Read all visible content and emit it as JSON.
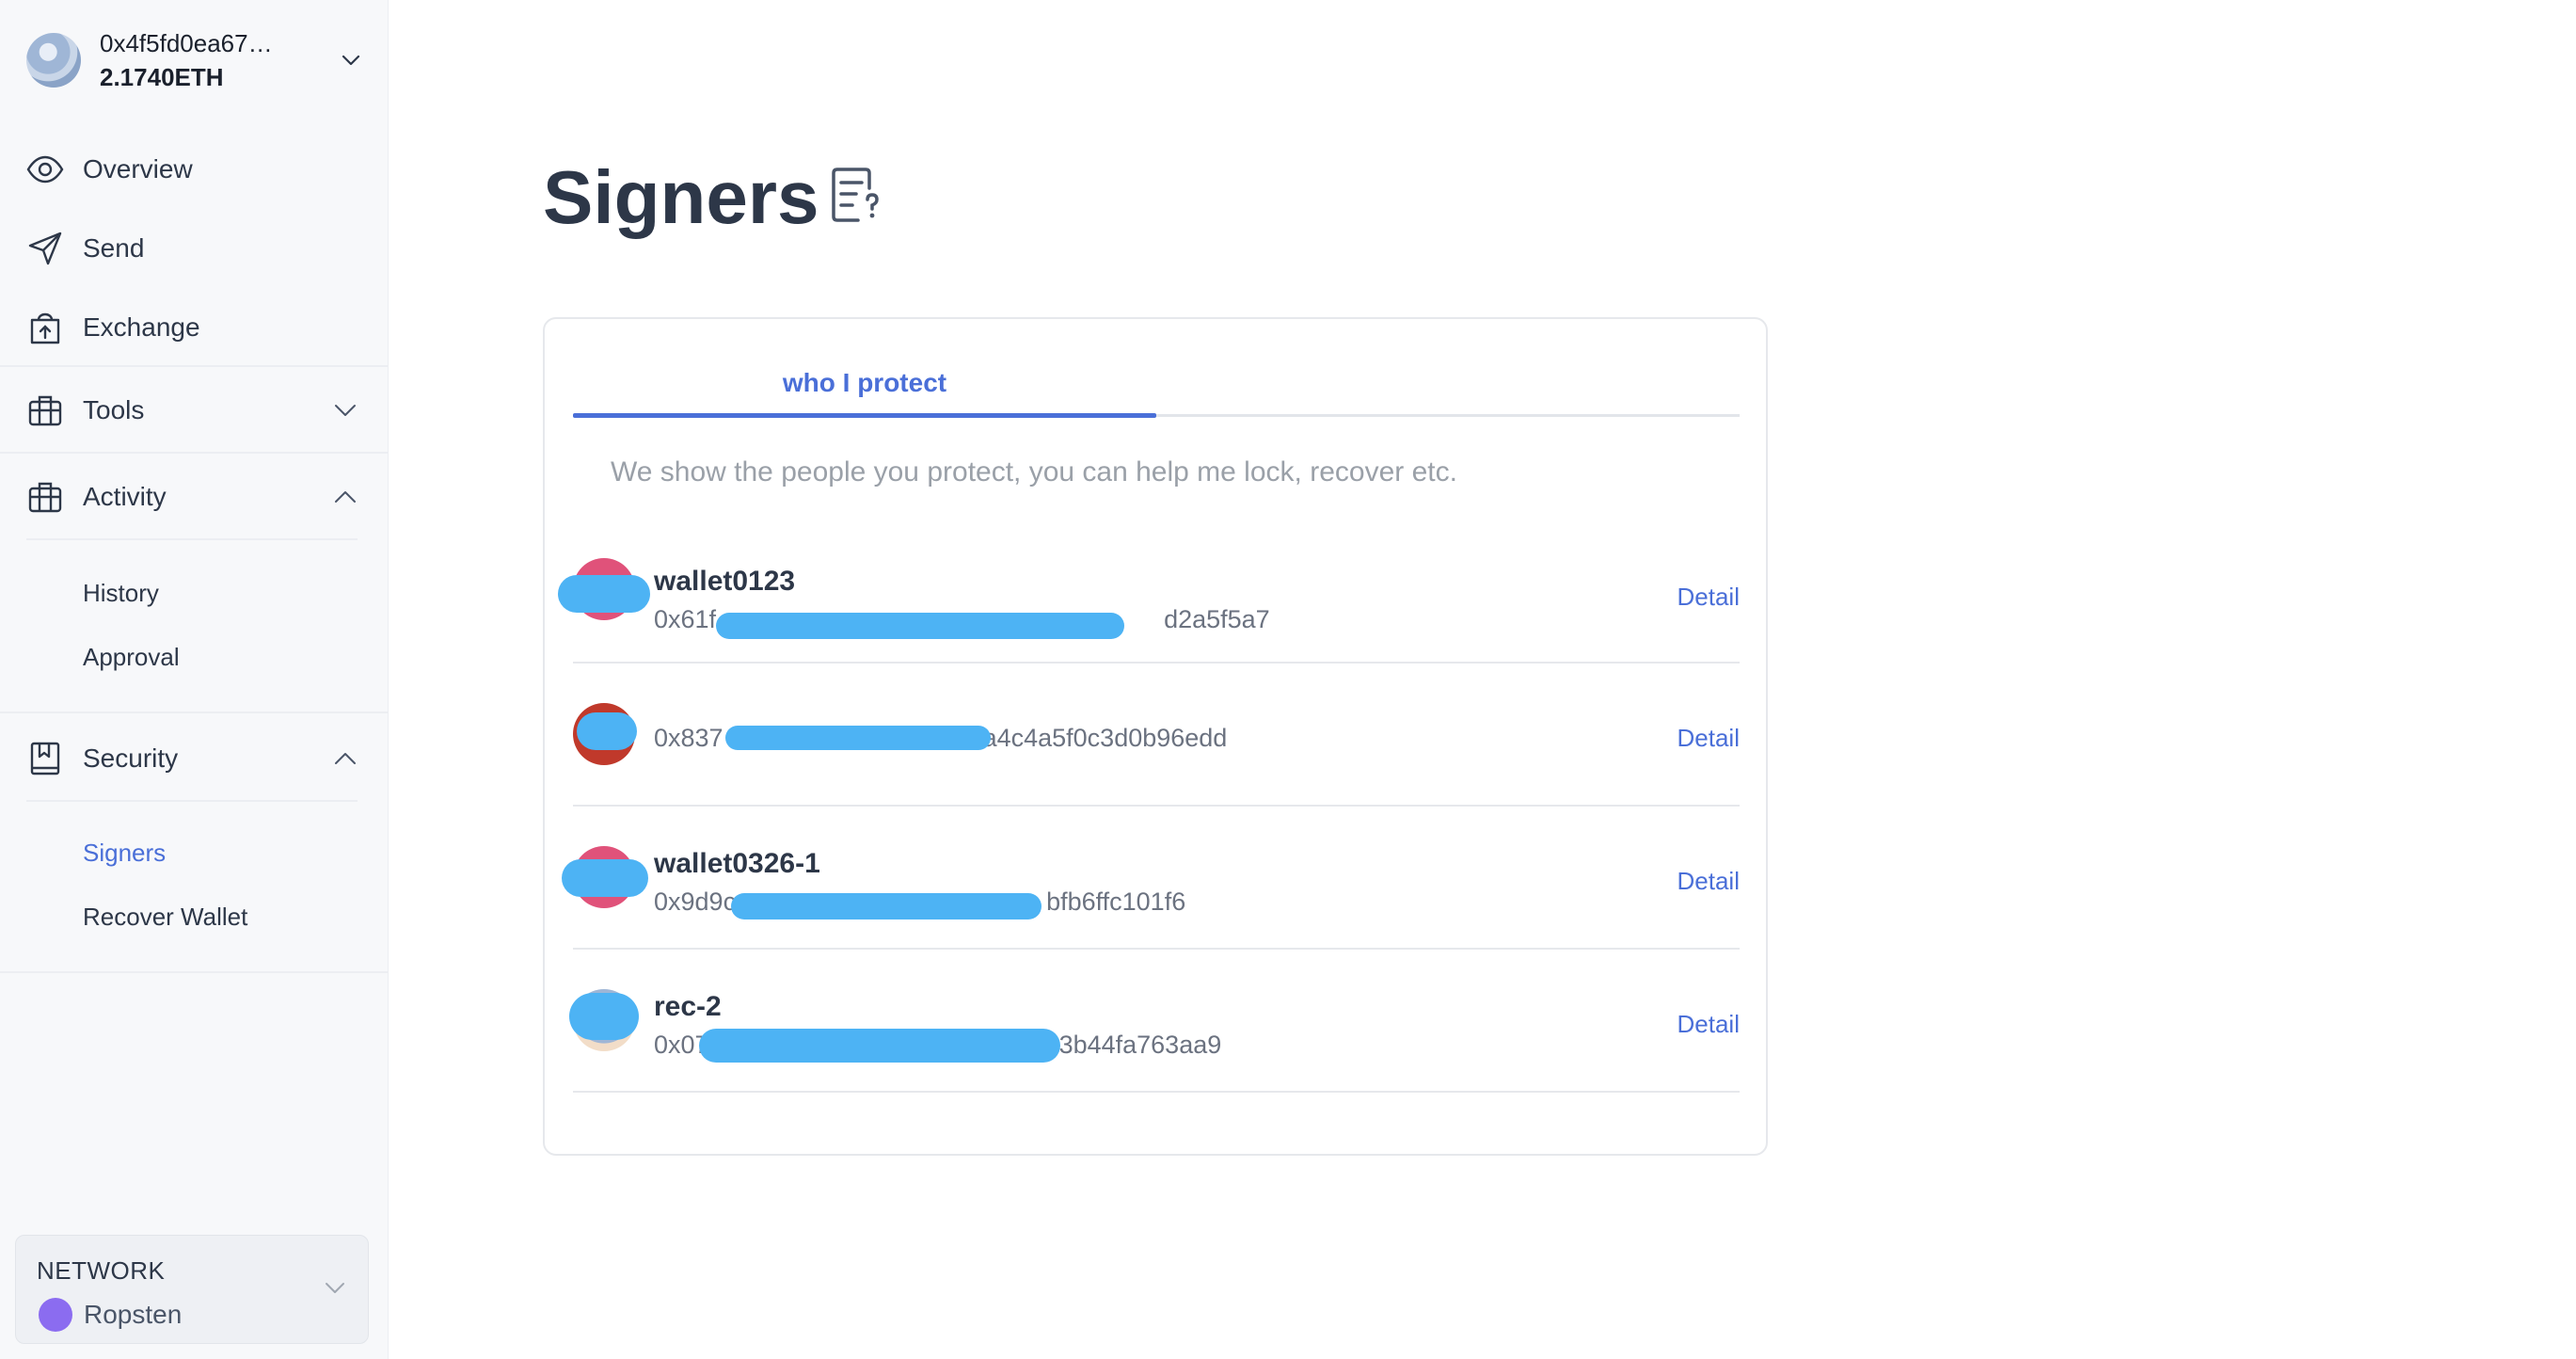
{
  "account": {
    "address": "0x4f5fd0ea67…",
    "balance": "2.1740ETH",
    "avatar_icon": "wallet-avatar"
  },
  "sidebar": {
    "items": [
      {
        "label": "Overview",
        "icon": "eye-icon"
      },
      {
        "label": "Send",
        "icon": "paper-plane-icon"
      },
      {
        "label": "Exchange",
        "icon": "shopping-bag-icon"
      },
      {
        "label": "Tools",
        "icon": "toolbox-icon",
        "expanded": false
      },
      {
        "label": "Activity",
        "icon": "briefcase-icon",
        "expanded": true,
        "children": [
          {
            "label": "History"
          },
          {
            "label": "Approval"
          }
        ]
      },
      {
        "label": "Security",
        "icon": "book-icon",
        "expanded": true,
        "children": [
          {
            "label": "Signers",
            "active": true
          },
          {
            "label": "Recover Wallet"
          }
        ]
      }
    ]
  },
  "network": {
    "title": "NETWORK",
    "name": "Ropsten",
    "dot_color": "#8b6cf0"
  },
  "page": {
    "title": "Signers",
    "help_icon": "document-question-icon"
  },
  "tabs": [
    {
      "label": "who I protect",
      "active": true
    }
  ],
  "tab_description": "We show the people you protect, you can help me lock, recover etc.",
  "signers": [
    {
      "name": "wallet0123",
      "address_start": "0x61f",
      "address_end": "d2a5f5a7",
      "action": "Detail"
    },
    {
      "name": "",
      "address_start": "0x837",
      "address_end": "a4c4a5f0c3d0b96edd",
      "action": "Detail"
    },
    {
      "name": "wallet0326-1",
      "address_start": "0x9d9c",
      "address_end": "bfb6ffc101f6",
      "action": "Detail"
    },
    {
      "name": "rec-2",
      "address_start": "0x07",
      "address_end": "3b44fa763aa9",
      "action": "Detail"
    }
  ],
  "colors": {
    "accent": "#4a6fd8",
    "sidebar_bg": "#f7f8fa",
    "redaction": "#4db3f4"
  }
}
